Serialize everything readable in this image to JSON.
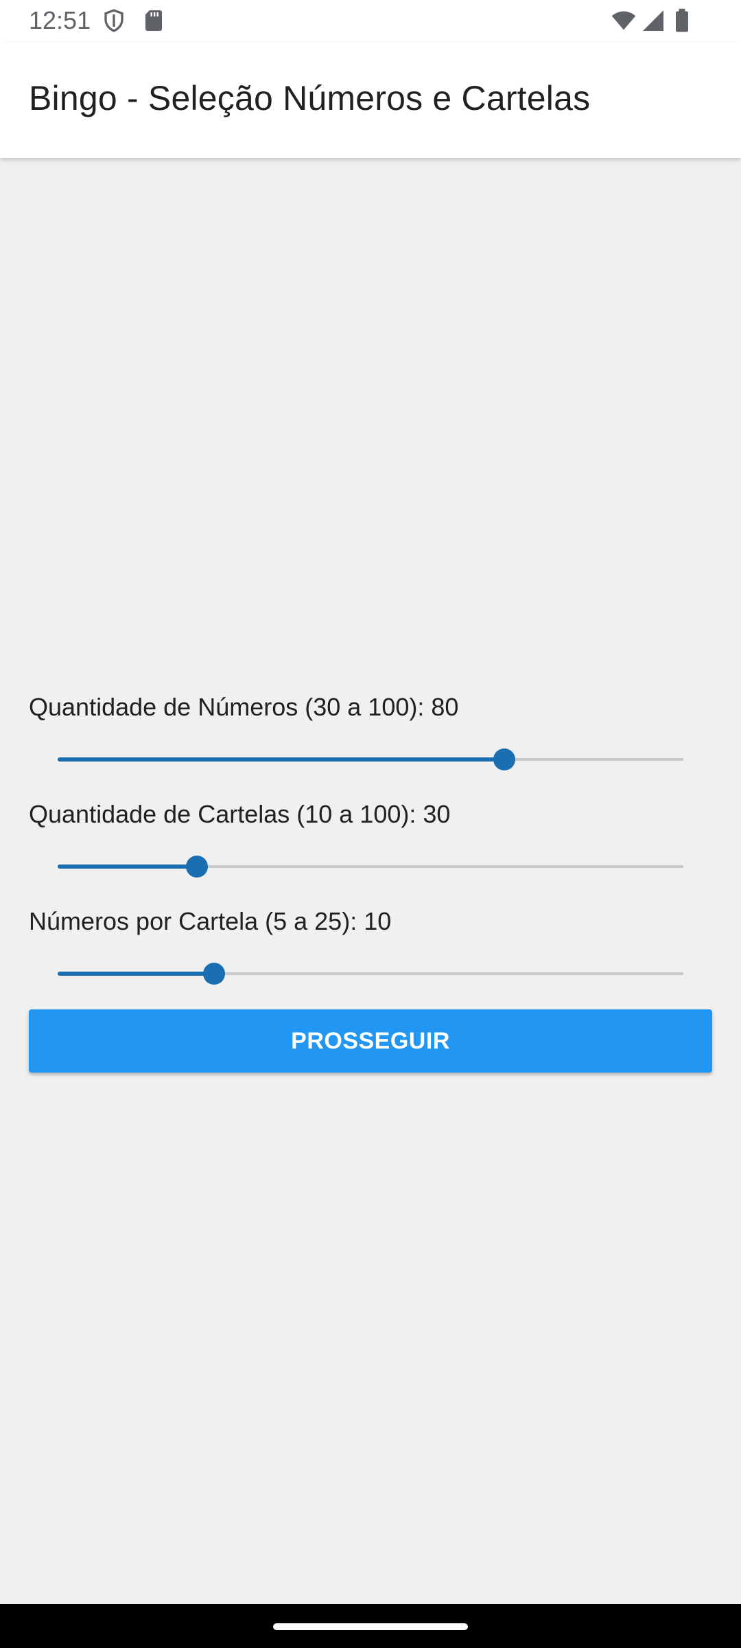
{
  "status_bar": {
    "time": "12:51",
    "left_icons": [
      "shield-icon",
      "sd-card-icon"
    ],
    "right_icons": [
      "wifi-icon",
      "cell-signal-icon",
      "battery-icon"
    ]
  },
  "app_bar": {
    "title": "Bingo - Seleção Números e Cartelas"
  },
  "sliders": [
    {
      "label": "Quantidade de Números (30 a 100): 80",
      "min": 30,
      "max": 100,
      "value": 80
    },
    {
      "label": "Quantidade de Cartelas (10 a 100): 30",
      "min": 10,
      "max": 100,
      "value": 30
    },
    {
      "label": "Números por Cartela (5 a 25): 10",
      "min": 5,
      "max": 25,
      "value": 10
    }
  ],
  "actions": {
    "proceed_label": "PROSSEGUIR"
  },
  "colors": {
    "accent": "#1a6fb3",
    "button": "#2196f3",
    "background": "#f0f0f0",
    "app_bar": "#ffffff"
  }
}
